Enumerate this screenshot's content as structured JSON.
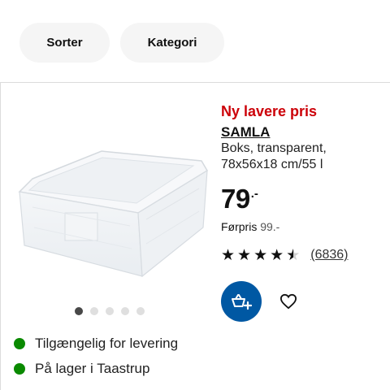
{
  "filters": {
    "sort_label": "Sorter",
    "category_label": "Kategori"
  },
  "product": {
    "badge": "Ny lavere pris",
    "name": "SAMLA",
    "description_line1": "Boks, transparent,",
    "description_line2": "78x56x18 cm/55 l",
    "price_integer": "79",
    "price_decimal": ".-",
    "previous_price_label": "Førpris",
    "previous_price_value": "99.-",
    "rating": 4.5,
    "rating_max": 5,
    "review_count": "(6836)",
    "image_carousel": {
      "count": 5,
      "active_index": 0
    }
  },
  "availability": {
    "delivery": "Tilgængelig for levering",
    "store": "På lager i Taastrup",
    "status_color": "#0a8a00"
  },
  "colors": {
    "badge_red": "#cc0008",
    "cart_blue": "#0058a3"
  },
  "icons": {
    "cart": "add-to-cart-icon",
    "favorite": "heart-icon"
  }
}
